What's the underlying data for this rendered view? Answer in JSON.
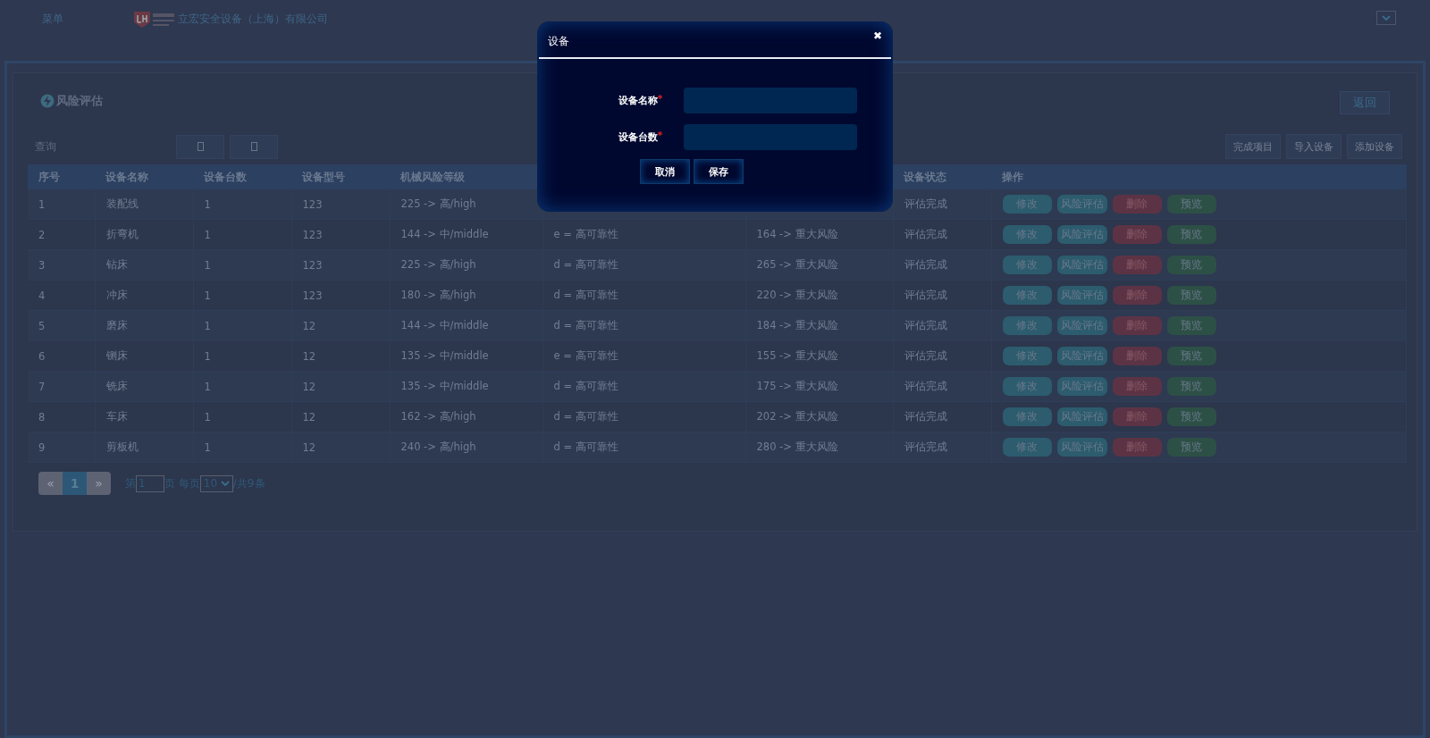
{
  "header": {
    "menu": "菜单",
    "company": "立宏安全设备（上海）有限公司"
  },
  "page": {
    "title": "风险评估",
    "back": "返回",
    "query_label": "查询",
    "actions": [
      "完成项目",
      "导入设备",
      "添加设备"
    ]
  },
  "table": {
    "columns": [
      "序号",
      "设备名称",
      "设备台数",
      "设备型号",
      "机械风险等级",
      "",
      "",
      "设备状态",
      "操作"
    ],
    "rows": [
      {
        "cells": [
          "1",
          "装配线",
          "1",
          "123",
          "225 -> 高/high",
          "",
          "",
          "评估完成"
        ],
        "actions": [
          "修改",
          "风险评估",
          "删除",
          "预览"
        ]
      },
      {
        "cells": [
          "2",
          "折弯机",
          "1",
          "123",
          "144 -> 中/middle",
          "e = 高可靠性",
          "164 -> 重大风险",
          "评估完成"
        ],
        "actions": [
          "修改",
          "风险评估",
          "删除",
          "预览"
        ]
      },
      {
        "cells": [
          "3",
          "钻床",
          "1",
          "123",
          "225 -> 高/high",
          "d = 高可靠性",
          "265 -> 重大风险",
          "评估完成"
        ],
        "actions": [
          "修改",
          "风险评估",
          "删除",
          "预览"
        ]
      },
      {
        "cells": [
          "4",
          "冲床",
          "1",
          "123",
          "180 -> 高/high",
          "d = 高可靠性",
          "220 -> 重大风险",
          "评估完成"
        ],
        "actions": [
          "修改",
          "风险评估",
          "删除",
          "预览"
        ]
      },
      {
        "cells": [
          "5",
          "磨床",
          "1",
          "12",
          "144 -> 中/middle",
          "d = 高可靠性",
          "184 -> 重大风险",
          "评估完成"
        ],
        "actions": [
          "修改",
          "风险评估",
          "删除",
          "预览"
        ]
      },
      {
        "cells": [
          "6",
          "铡床",
          "1",
          "12",
          "135 -> 中/middle",
          "e = 高可靠性",
          "155 -> 重大风险",
          "评估完成"
        ],
        "actions": [
          "修改",
          "风险评估",
          "删除",
          "预览"
        ]
      },
      {
        "cells": [
          "7",
          "铣床",
          "1",
          "12",
          "135 -> 中/middle",
          "d = 高可靠性",
          "175 -> 重大风险",
          "评估完成"
        ],
        "actions": [
          "修改",
          "风险评估",
          "删除",
          "预览"
        ]
      },
      {
        "cells": [
          "8",
          "车床",
          "1",
          "12",
          "162 -> 高/high",
          "d = 高可靠性",
          "202 -> 重大风险",
          "评估完成"
        ],
        "actions": [
          "修改",
          "风险评估",
          "删除",
          "预览"
        ]
      },
      {
        "cells": [
          "9",
          "剪板机",
          "1",
          "12",
          "240 -> 高/high",
          "d = 高可靠性",
          "280 -> 重大风险",
          "评估完成"
        ],
        "actions": [
          "修改",
          "风险评估",
          "删除",
          "预览"
        ]
      }
    ]
  },
  "pagination": {
    "prev": "«",
    "pages": [
      {
        "label": "1",
        "selected": true
      }
    ],
    "next": "»",
    "page_prefix": "第",
    "page_value": "1",
    "page_suffix": "页 每页",
    "page_size": "10",
    "total": "/共9条"
  },
  "dialog": {
    "title": "设备",
    "close": "✖",
    "fields": [
      {
        "label": "设备名称",
        "required": true
      },
      {
        "label": "设备台数",
        "required": true
      }
    ],
    "buttons": [
      "取消",
      "保存"
    ]
  }
}
